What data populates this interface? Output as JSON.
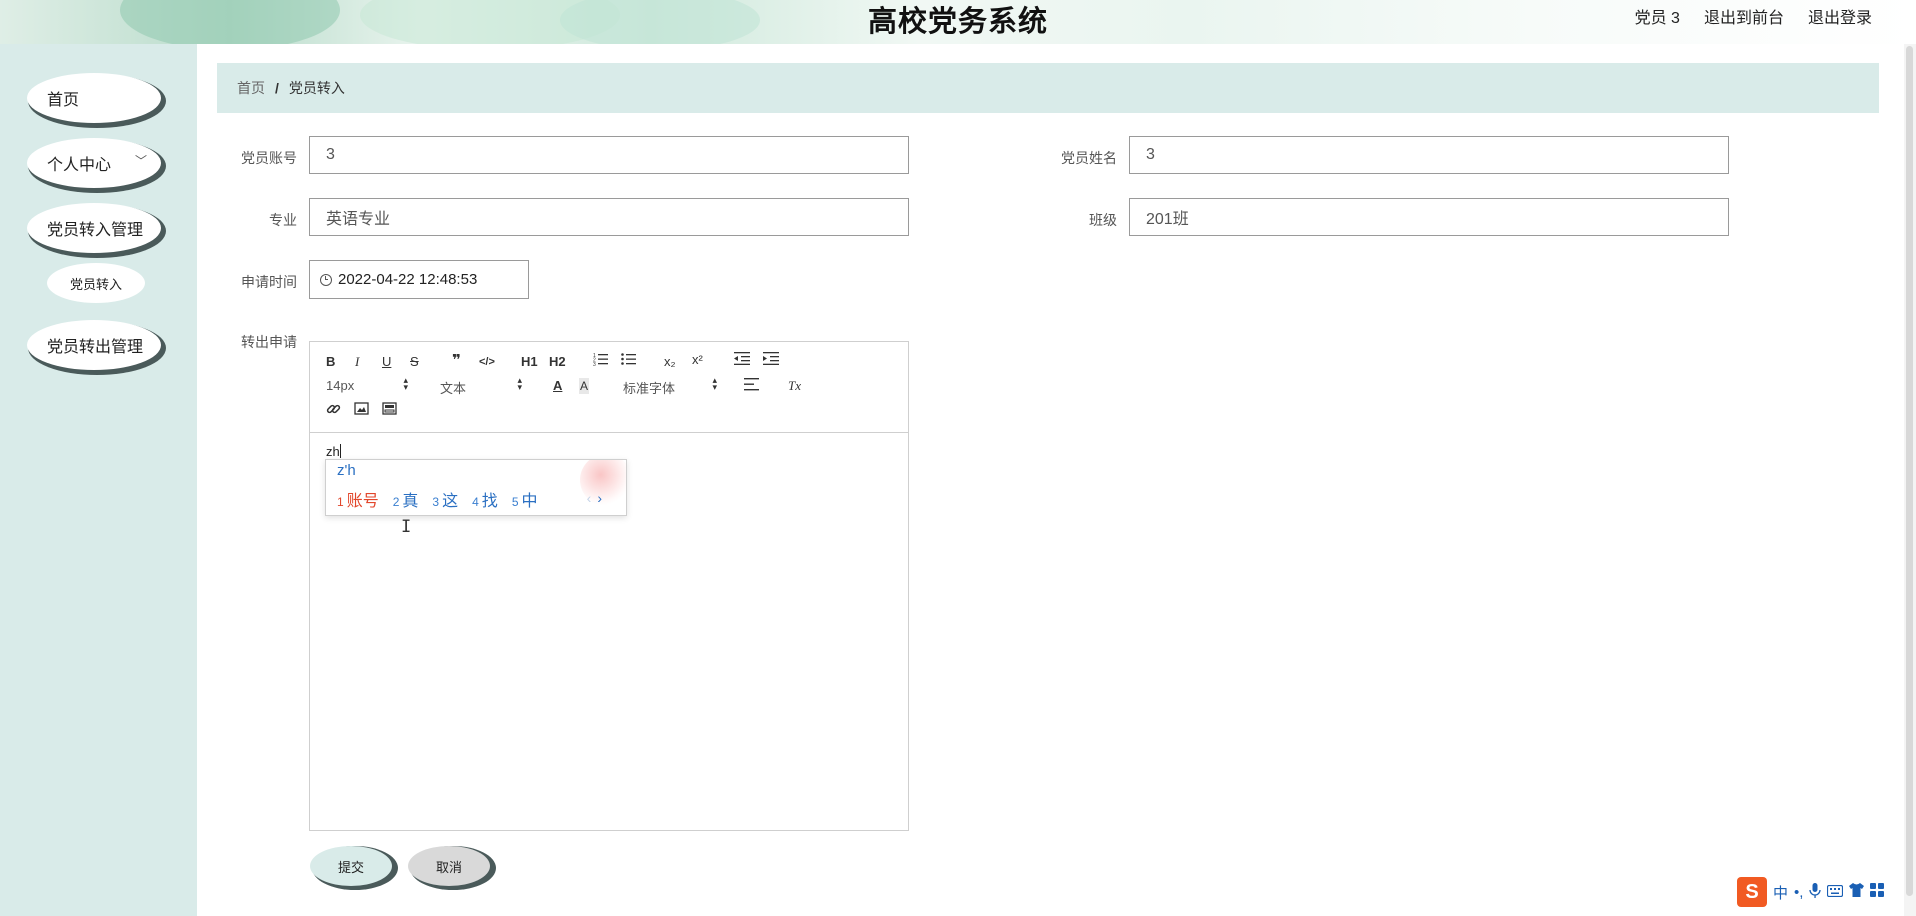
{
  "app": {
    "title": "高校党务系统"
  },
  "header": {
    "user_label": "党员 3",
    "front_link": "退出到前台",
    "logout_link": "退出登录"
  },
  "sidebar": {
    "items": [
      {
        "label": "首页"
      },
      {
        "label": "个人中心",
        "chevron": "chevron-down-icon"
      },
      {
        "label": "党员转入管理"
      },
      {
        "label": "党员转入",
        "sub": true
      },
      {
        "label": "党员转出管理"
      }
    ]
  },
  "breadcrumb": {
    "home": "首页",
    "separator": "/",
    "current": "党员转入"
  },
  "form": {
    "account": {
      "label": "党员账号",
      "value": "3"
    },
    "name": {
      "label": "党员姓名",
      "value": "3"
    },
    "major": {
      "label": "专业",
      "value": "英语专业"
    },
    "class": {
      "label": "班级",
      "value": "201班"
    },
    "apply_time": {
      "label": "申请时间",
      "value": "2022-04-22 12:48:53"
    },
    "transfer_request": {
      "label": "转出申请"
    }
  },
  "editor": {
    "toolbar": {
      "bold": "B",
      "italic": "I",
      "underline": "U",
      "strike": "S",
      "quote": "❞",
      "code": "</>",
      "h1": "H1",
      "h2": "H2",
      "sub": "x₂",
      "sup": "x²",
      "size": "14px",
      "format": "文本",
      "font": "标准字体",
      "clear": "Tx"
    },
    "content": "zh"
  },
  "ime": {
    "composition": "z'h",
    "candidates": [
      {
        "num": "1",
        "word": "账号"
      },
      {
        "num": "2",
        "word": "真"
      },
      {
        "num": "3",
        "word": "这"
      },
      {
        "num": "4",
        "word": "找"
      },
      {
        "num": "5",
        "word": "中"
      }
    ],
    "pager": {
      "prev": "‹",
      "next": "›"
    },
    "status": {
      "logo": "S",
      "lang": "中",
      "punct": "•,"
    }
  },
  "buttons": {
    "submit": "提交",
    "cancel": "取消"
  },
  "colors": {
    "accent": "#d9ebe9",
    "shadow": "#4a5a5a",
    "ime_highlight": "#e2462b",
    "ime_blue": "#2a6fc2"
  }
}
